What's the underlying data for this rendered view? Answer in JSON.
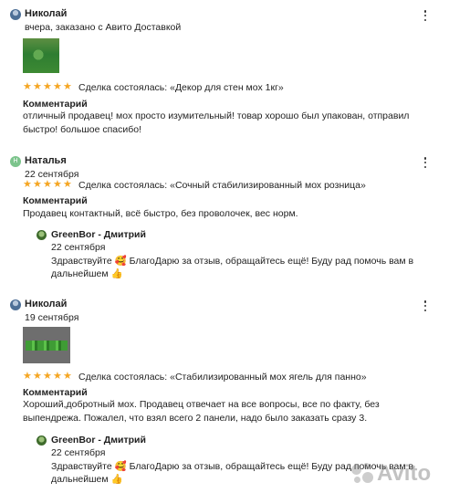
{
  "reviews": [
    {
      "author": "Николай",
      "avatar_kind": "photo",
      "meta": "вчера, заказано с Авито Доставкой",
      "rating": 5,
      "deal": "Сделка состоялась: «Декор для стен мох 1кг»",
      "comment_label": "Комментарий",
      "comment": "отличный продавец! мох просто изумительный! товар хорошо был упакован, отправил быстро! большое спасибо!",
      "has_photo": true
    },
    {
      "author": "Наталья",
      "avatar_letter": "Н",
      "meta": "22 сентября",
      "rating": 5,
      "deal": "Сделка состоялась: «Сочный стабилизированный мох розница»",
      "comment_label": "Комментарий",
      "comment": "Продавец контактный, всё быстро, без проволочек, вес норм.",
      "reply": {
        "author": "GreenBor - Дмитрий",
        "date": "22 сентября",
        "text": "Здравствуйте 🥰 БлагоДарю за отзыв, обращайтесь ещё! Буду рад помочь вам в дальнейшем 👍"
      }
    },
    {
      "author": "Николай",
      "avatar_kind": "photo",
      "meta": "19 сентября",
      "rating": 5,
      "deal": "Сделка состоялась: «Стабилизированный мох ягель для панно»",
      "comment_label": "Комментарий",
      "comment": "Хороший,добротный мох. Продавец отвечает на все вопросы, все по факту, без выпендрежа. Пожалел, что взял всего 2 панели, надо было заказать сразу 3.",
      "has_photo": true,
      "reply": {
        "author": "GreenBor - Дмитрий",
        "date": "22 сентября",
        "text": "Здравствуйте 🥰 БлагоДарю за отзыв, обращайтесь ещё! Буду рад помочь вам в дальнейшем 👍"
      }
    }
  ],
  "star_char": "★",
  "watermark": "Avito",
  "colors": {
    "star": "#f5a623",
    "letter_avatar": "#7cc48c"
  }
}
